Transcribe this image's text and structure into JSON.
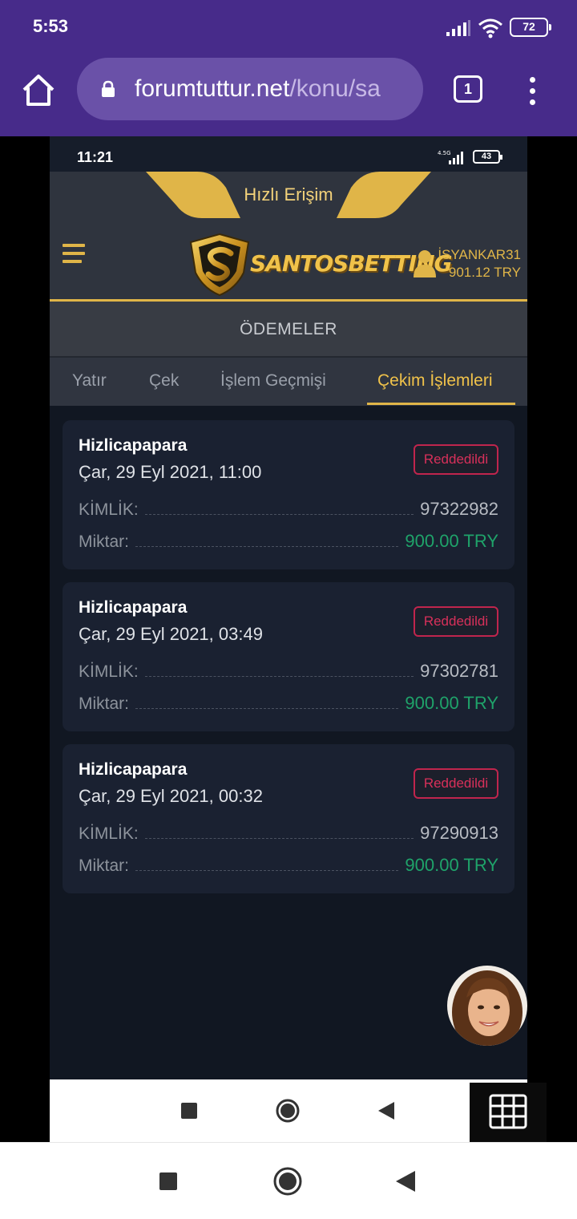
{
  "phone": {
    "time": "5:53",
    "battery": "72"
  },
  "browser": {
    "url_domain": "forumtuttur.net",
    "url_path": "/konu/sa",
    "tab_count": "1"
  },
  "inner_phone": {
    "time": "11:21",
    "network": "4.5G",
    "battery": "43"
  },
  "site": {
    "quick_access": "Hızlı Erişim",
    "logo_text": "SANTOSBETTING",
    "username": "İSYANKAR31",
    "balance": "901.12 TRY",
    "section_title": "ÖDEMELER",
    "tabs": [
      {
        "label": "Yatır"
      },
      {
        "label": "Çek"
      },
      {
        "label": "İşlem Geçmişi"
      },
      {
        "label": "Çekim İşlemleri"
      }
    ],
    "active_tab": "Çekim İşlemleri"
  },
  "transactions": [
    {
      "method": "Hizlicapapara",
      "date": "Çar, 29 Eyl 2021, 11:00",
      "status": "Reddedildi",
      "id_label": "KİMLİK:",
      "id": "97322982",
      "amount_label": "Miktar:",
      "amount": "900.00 TRY"
    },
    {
      "method": "Hizlicapapara",
      "date": "Çar, 29 Eyl 2021, 03:49",
      "status": "Reddedildi",
      "id_label": "KİMLİK:",
      "id": "97302781",
      "amount_label": "Miktar:",
      "amount": "900.00 TRY"
    },
    {
      "method": "Hizlicapapara",
      "date": "Çar, 29 Eyl 2021, 00:32",
      "status": "Reddedildi",
      "id_label": "KİMLİK:",
      "id": "97290913",
      "amount_label": "Miktar:",
      "amount": "900.00 TRY"
    }
  ],
  "colors": {
    "browser_bar": "#472b8a",
    "accent_gold": "#e0b548",
    "rejected_red": "#d8305a",
    "amount_green": "#1fa36a",
    "page_bg": "#111722",
    "card_bg": "#1a2131"
  },
  "icons": {
    "home": "home-icon",
    "lock": "lock-icon",
    "menu": "more-vert-icon",
    "hamburger": "hamburger-menu-icon",
    "user": "user-icon",
    "keypad": "grid-keypad-icon",
    "nav_recent": "square-recents-icon",
    "nav_home": "circle-home-icon",
    "nav_back": "triangle-back-icon"
  }
}
